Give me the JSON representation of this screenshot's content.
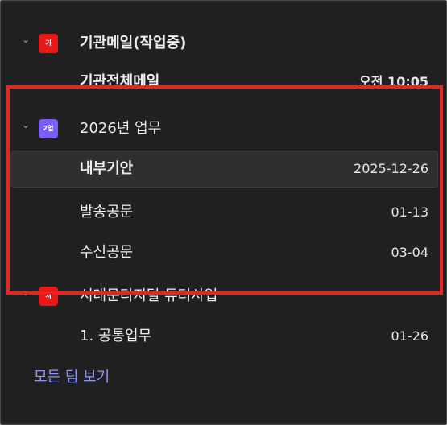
{
  "groups": [
    {
      "badge_text": "기",
      "badge_color": "#e81919",
      "title": "기관메일(작업중)",
      "items": [
        {
          "title": "기관전체메일",
          "date": "오전 10:05"
        }
      ]
    },
    {
      "badge_text": "2업",
      "badge_color": "#7b5cf5",
      "title": "2026년 업무",
      "items": [
        {
          "title": "내부기안",
          "date": "2025-12-26"
        },
        {
          "title": "발송공문",
          "date": "01-13"
        },
        {
          "title": "수신공문",
          "date": "03-04"
        }
      ]
    },
    {
      "badge_text": "서",
      "badge_color": "#e81919",
      "title": "서대문디지털 튜터사업",
      "items": [
        {
          "title": "1. 공통업무",
          "date": "01-26"
        }
      ]
    }
  ],
  "see_all_label": "모든 팀 보기",
  "chevron_glyph": "⌄"
}
